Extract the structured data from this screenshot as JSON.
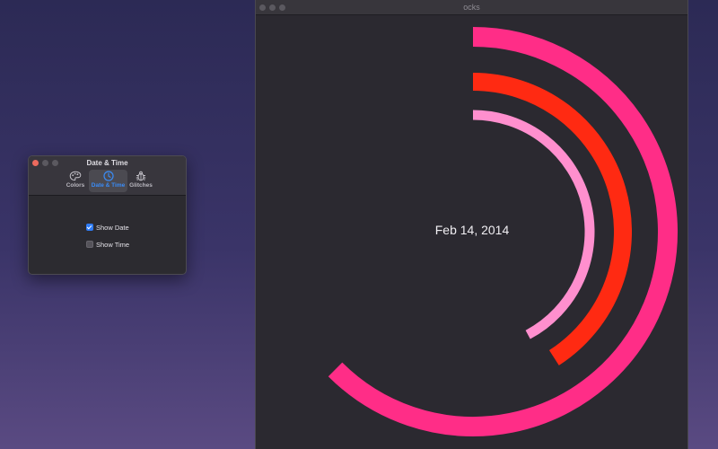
{
  "clock_window": {
    "title": "ocks",
    "date_text": "Feb 14, 2014",
    "rings": [
      {
        "name": "outer",
        "color": "#ff2d87",
        "fraction": 0.625
      },
      {
        "name": "middle",
        "color": "#ff2a12",
        "fraction": 0.409
      },
      {
        "name": "inner",
        "color": "#ff8fce",
        "fraction": 0.422
      }
    ]
  },
  "prefs_window": {
    "title": "Date & Time",
    "tabs": [
      {
        "label": "Colors",
        "icon": "palette-icon"
      },
      {
        "label": "Date & Time",
        "icon": "clock-icon"
      },
      {
        "label": "Glitches",
        "icon": "bug-icon"
      }
    ],
    "active_tab": "Date & Time",
    "options": [
      {
        "label": "Show Date",
        "checked": true
      },
      {
        "label": "Show Time",
        "checked": false
      }
    ]
  },
  "colors": {
    "accent": "#2f7cf6",
    "close_red": "#ec6a5e",
    "window_bg": "#2b2930"
  }
}
